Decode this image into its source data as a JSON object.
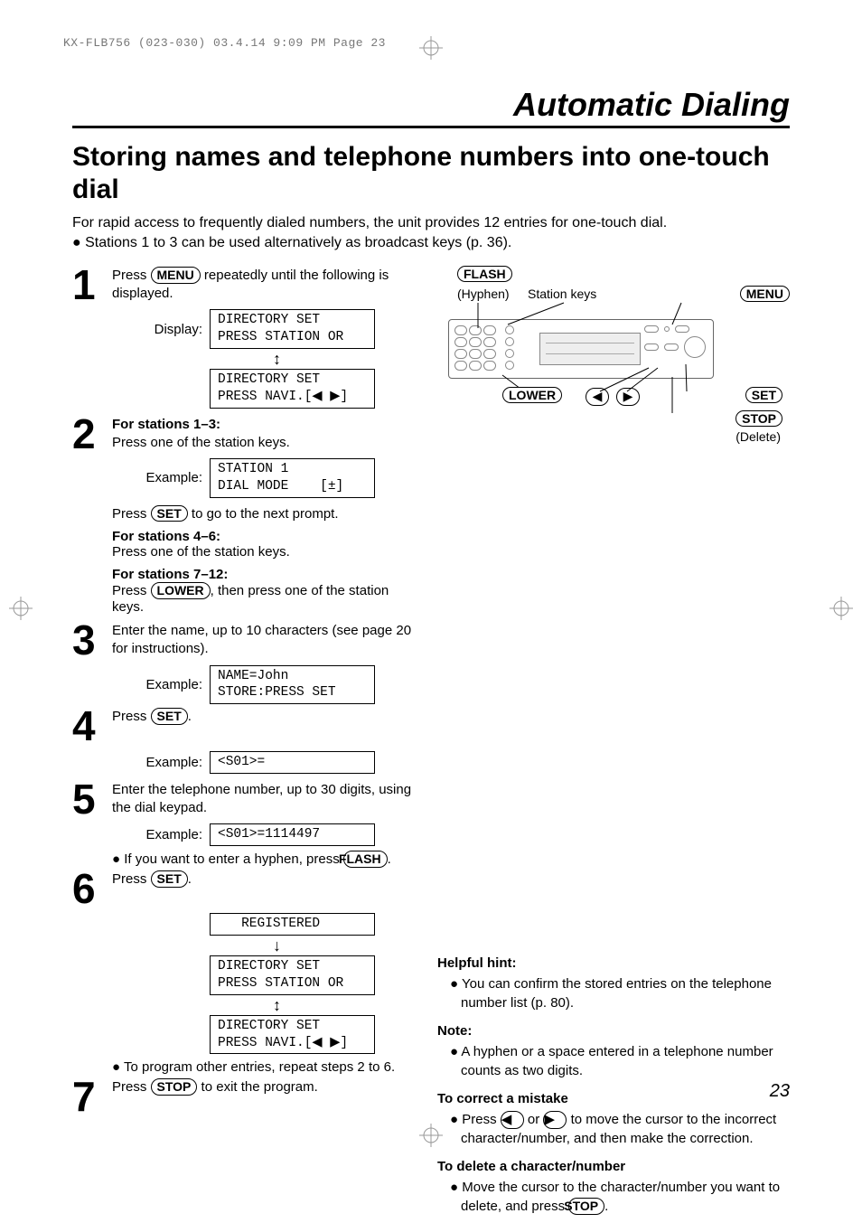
{
  "runhead": "KX-FLB756 (023-030)  03.4.14  9:09 PM  Page 23",
  "chapter": "Automatic Dialing",
  "section_title": "Storing names and telephone numbers into one-touch dial",
  "intro_line": "For rapid access to frequently dialed numbers, the unit provides 12 entries for one-touch dial.",
  "intro_bullet": "Stations 1 to 3 can be used alternatively as broadcast keys (p. 36).",
  "steps": {
    "s1": {
      "text_a": "Press ",
      "btn": "MENU",
      "text_b": " repeatedly until the following is displayed.",
      "display_label": "Display:",
      "lcd1": "DIRECTORY SET\nPRESS STATION OR",
      "lcd2": "DIRECTORY SET\nPRESS NAVI.[◀ ▶]"
    },
    "s2": {
      "h1": "For stations 1–3:",
      "l1": "Press one of the station keys.",
      "example_label": "Example:",
      "lcd": "STATION 1\nDIAL MODE    [±]",
      "press_prefix": "Press ",
      "press_btn": "SET",
      "press_suffix": " to go to the next prompt.",
      "h2": "For stations 4–6:",
      "l2": "Press one of the station keys.",
      "h3": "For stations 7–12:",
      "l3a": "Press ",
      "l3btn": "LOWER",
      "l3b": ", then press one of the station keys."
    },
    "s3": {
      "text": "Enter the name, up to 10 characters (see page 20 for instructions).",
      "example_label": "Example:",
      "lcd": "NAME=John\nSTORE:PRESS SET"
    },
    "s4": {
      "text_a": "Press ",
      "btn": "SET",
      "text_b": ".",
      "example_label": "Example:",
      "lcd": "<S01>="
    },
    "s5": {
      "text": "Enter the telephone number, up to 30 digits, using the dial keypad.",
      "example_label": "Example:",
      "lcd": "<S01>=1114497",
      "bullet_a": "If you want to enter a hyphen, press ",
      "bullet_btn": "FLASH",
      "bullet_b": "."
    },
    "s6": {
      "text_a": "Press ",
      "btn": "SET",
      "text_b": ".",
      "lcd1": "   REGISTERED",
      "lcd2": "DIRECTORY SET\nPRESS STATION OR",
      "lcd3": "DIRECTORY SET\nPRESS NAVI.[◀ ▶]",
      "bullet": "To program other entries, repeat steps 2 to 6."
    },
    "s7": {
      "text_a": "Press ",
      "btn": "STOP",
      "text_b": " to exit the program."
    }
  },
  "diagram": {
    "flash": "FLASH",
    "hyphen": "(Hyphen)",
    "station_keys": "Station keys",
    "menu": "MENU",
    "lower": "LOWER",
    "set": "SET",
    "stop": "STOP",
    "delete": "(Delete)",
    "left": "◀",
    "right": "▶"
  },
  "right_col": {
    "hh_title": "Helpful hint:",
    "hh_item": "You can confirm the stored entries on the telephone number list (p. 80).",
    "note_title": "Note:",
    "note_item": "A hyphen or a space entered in a telephone number counts as two digits.",
    "correct_title": "To correct a mistake",
    "correct_item_a": "Press ",
    "correct_item_b": " or ",
    "correct_item_c": " to move the cursor to the incorrect character/number, and then make the correction.",
    "delete_title": "To delete a character/number",
    "delete_item_a": "Move the cursor to the character/number you want to delete, and press ",
    "delete_btn": "STOP",
    "delete_item_b": "."
  },
  "pagenum": "23"
}
